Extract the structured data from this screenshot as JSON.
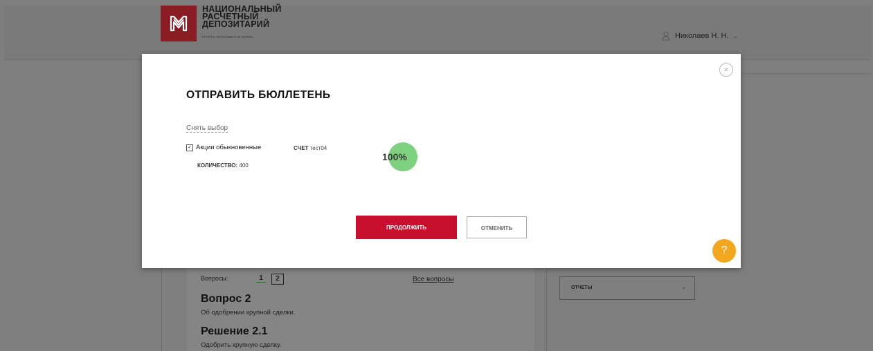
{
  "header": {
    "logo_lines": [
      "НАЦИОНАЛЬНЫЙ",
      "РАСЧЕТНЫЙ",
      "ДЕПОЗИТАРИЙ"
    ],
    "logo_sub": "ГРУППА МОСКОВСКАЯ БИРЖА",
    "user_name": "Николаев Н. Н.",
    "user_icon": "user-icon",
    "chevron_icon": "chevron-down-icon"
  },
  "background": {
    "questions_label": "Вопросы:",
    "question_numbers": [
      "1",
      "2"
    ],
    "all_questions": "Все вопросы",
    "question_title": "Вопрос 2",
    "question_desc": "Об одобрении крупной сделки.",
    "decision_title": "Решение 2.1",
    "decision_desc": "Одобрить крупную сделку.",
    "reports_label": "ОТЧЕТЫ"
  },
  "modal": {
    "title": "ОТПРАВИТЬ БЮЛЛЕТЕНЬ",
    "deselect": "Снять выбор",
    "item": {
      "label": "Акции обыкновенные",
      "account_label": "СЧЕТ",
      "account_value": "тест04",
      "qty_label": "КОЛИЧЕСТВО:",
      "qty_value": "400",
      "checked": true
    },
    "progress": {
      "value": 100,
      "text": "100%"
    },
    "continue_label": "ПРОДОЛЖИТЬ",
    "cancel_label": "ОТМЕНИТЬ",
    "close_icon": "close-icon"
  },
  "help": {
    "label": "?"
  },
  "colors": {
    "accent_red": "#c8102e",
    "progress_green": "#7ed17e",
    "help_orange": "#f2a71f",
    "overlay_gray": "#7e7e7e"
  }
}
